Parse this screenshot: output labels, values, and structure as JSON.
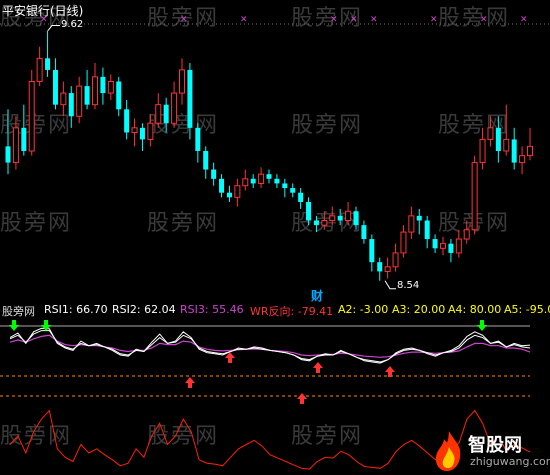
{
  "title": "平安银行(日线)",
  "price_high_label": "9.62",
  "price_low_label": "8.54",
  "finance_marker": "财",
  "indicator": {
    "name": "股旁网",
    "items": [
      {
        "text": "RSI1: 66.70",
        "color": "#ffffff"
      },
      {
        "text": "RSI2: 62.04",
        "color": "#ffffff"
      },
      {
        "text": "RSI3: 55.46",
        "color": "#cc44cc"
      },
      {
        "text": "WR反向: -79.41",
        "color": "#ff3333"
      },
      {
        "text": "A2: -3.00",
        "color": "#ffff00"
      },
      {
        "text": "A3: 20.00",
        "color": "#ffff00"
      },
      {
        "text": "A4: 80.00",
        "color": "#ffff00"
      },
      {
        "text": "A5: -95.0",
        "color": "#ffff00"
      }
    ]
  },
  "watermarks": [
    "股旁网",
    "股旁网",
    "股旁网",
    "股旁网",
    "股旁网",
    "股旁网",
    "股旁网",
    "股旁网",
    "股旁网",
    "股旁网",
    "股旁网",
    "股旁网",
    "股旁网",
    "股旁网",
    "股旁网"
  ],
  "logo": {
    "name": "智股网",
    "url": "zhiguwang.com"
  },
  "colors": {
    "up": "#ff3333",
    "down": "#00ffff",
    "rsi1": "#ffffff",
    "rsi2": "#ffffff",
    "rsi3": "#cc44cc",
    "wr": "#ff2200",
    "dashed": "#ff8800",
    "arrow_up": "#ff3333",
    "arrow_down": "#00ff00"
  },
  "chart_data": [
    {
      "type": "candlestick",
      "title": "平安银行(日线)",
      "annotations": [
        {
          "label": "9.62",
          "type": "high"
        },
        {
          "label": "8.54",
          "type": "low"
        }
      ],
      "candles": [
        [
          9.12,
          9.05,
          9.28,
          9.0
        ],
        [
          9.05,
          9.2,
          9.25,
          9.02
        ],
        [
          9.2,
          9.1,
          9.3,
          9.08
        ],
        [
          9.1,
          9.4,
          9.45,
          9.08
        ],
        [
          9.4,
          9.5,
          9.55,
          9.38
        ],
        [
          9.5,
          9.45,
          9.62,
          9.42
        ],
        [
          9.45,
          9.3,
          9.5,
          9.28
        ],
        [
          9.3,
          9.35,
          9.4,
          9.25
        ],
        [
          9.35,
          9.25,
          9.38,
          9.2
        ],
        [
          9.25,
          9.38,
          9.42,
          9.22
        ],
        [
          9.38,
          9.3,
          9.45,
          9.28
        ],
        [
          9.3,
          9.42,
          9.48,
          9.28
        ],
        [
          9.42,
          9.35,
          9.46,
          9.3
        ],
        [
          9.35,
          9.4,
          9.43,
          9.32
        ],
        [
          9.4,
          9.28,
          9.42,
          9.25
        ],
        [
          9.28,
          9.18,
          9.32,
          9.15
        ],
        [
          9.18,
          9.2,
          9.24,
          9.12
        ],
        [
          9.2,
          9.15,
          9.22,
          9.1
        ],
        [
          9.15,
          9.22,
          9.26,
          9.12
        ],
        [
          9.22,
          9.3,
          9.35,
          9.2
        ],
        [
          9.3,
          9.22,
          9.33,
          9.18
        ],
        [
          9.22,
          9.35,
          9.4,
          9.2
        ],
        [
          9.35,
          9.45,
          9.5,
          9.3
        ],
        [
          9.45,
          9.2,
          9.48,
          9.15
        ],
        [
          9.2,
          9.1,
          9.22,
          9.05
        ],
        [
          9.1,
          9.02,
          9.12,
          8.98
        ],
        [
          9.02,
          8.98,
          9.05,
          8.95
        ],
        [
          8.98,
          8.92,
          9.0,
          8.9
        ],
        [
          8.92,
          8.9,
          8.95,
          8.88
        ],
        [
          8.9,
          8.95,
          8.98,
          8.86
        ],
        [
          8.95,
          8.98,
          9.02,
          8.93
        ],
        [
          8.98,
          8.96,
          9.0,
          8.94
        ],
        [
          8.96,
          9.0,
          9.03,
          8.94
        ],
        [
          9.0,
          8.98,
          9.02,
          8.96
        ],
        [
          8.98,
          8.96,
          9.0,
          8.94
        ],
        [
          8.96,
          8.94,
          8.98,
          8.9
        ],
        [
          8.94,
          8.92,
          8.96,
          8.9
        ],
        [
          8.92,
          8.88,
          8.94,
          8.85
        ],
        [
          8.88,
          8.8,
          8.9,
          8.78
        ],
        [
          8.8,
          8.78,
          8.82,
          8.75
        ],
        [
          8.78,
          8.8,
          8.84,
          8.76
        ],
        [
          8.8,
          8.82,
          8.86,
          8.78
        ],
        [
          8.82,
          8.8,
          8.85,
          8.78
        ],
        [
          8.8,
          8.84,
          8.88,
          8.78
        ],
        [
          8.84,
          8.78,
          8.86,
          8.76
        ],
        [
          8.78,
          8.72,
          8.8,
          8.7
        ],
        [
          8.72,
          8.62,
          8.74,
          8.58
        ],
        [
          8.62,
          8.58,
          8.64,
          8.54
        ],
        [
          8.58,
          8.6,
          8.64,
          8.55
        ],
        [
          8.6,
          8.66,
          8.7,
          8.58
        ],
        [
          8.66,
          8.75,
          8.78,
          8.64
        ],
        [
          8.75,
          8.82,
          8.86,
          8.72
        ],
        [
          8.82,
          8.8,
          8.85,
          8.74
        ],
        [
          8.8,
          8.72,
          8.82,
          8.68
        ],
        [
          8.72,
          8.68,
          8.74,
          8.66
        ],
        [
          8.68,
          8.7,
          8.73,
          8.65
        ],
        [
          8.7,
          8.66,
          8.72,
          8.62
        ],
        [
          8.66,
          8.72,
          8.76,
          8.64
        ],
        [
          8.72,
          8.76,
          8.8,
          8.7
        ],
        [
          8.76,
          9.05,
          9.08,
          8.74
        ],
        [
          9.05,
          9.15,
          9.2,
          9.02
        ],
        [
          9.15,
          9.2,
          9.25,
          9.12
        ],
        [
          9.2,
          9.1,
          9.25,
          9.05
        ],
        [
          9.1,
          9.15,
          9.3,
          9.08
        ],
        [
          9.15,
          9.05,
          9.2,
          9.02
        ],
        [
          9.05,
          9.08,
          9.12,
          9.0
        ],
        [
          9.08,
          9.12,
          9.2,
          9.06
        ]
      ]
    },
    {
      "type": "line",
      "title": "股旁网",
      "series": [
        {
          "name": "RSI1",
          "values": [
            80,
            88,
            70,
            90,
            96,
            95,
            70,
            62,
            58,
            74,
            66,
            70,
            64,
            58,
            50,
            48,
            60,
            56,
            72,
            86,
            70,
            74,
            90,
            80,
            60,
            54,
            52,
            50,
            56,
            62,
            60,
            64,
            62,
            58,
            56,
            54,
            50,
            42,
            40,
            48,
            52,
            50,
            58,
            52,
            46,
            40,
            38,
            36,
            42,
            54,
            60,
            62,
            58,
            52,
            48,
            54,
            58,
            66,
            82,
            90,
            84,
            70,
            74,
            64,
            70,
            66,
            67
          ]
        },
        {
          "name": "RSI2",
          "values": [
            78,
            84,
            72,
            86,
            92,
            92,
            72,
            64,
            60,
            70,
            66,
            68,
            64,
            60,
            52,
            50,
            58,
            56,
            68,
            80,
            70,
            72,
            84,
            78,
            62,
            56,
            54,
            52,
            56,
            60,
            60,
            62,
            60,
            58,
            56,
            54,
            50,
            44,
            42,
            48,
            50,
            50,
            56,
            52,
            46,
            42,
            40,
            38,
            42,
            52,
            58,
            60,
            58,
            54,
            50,
            54,
            56,
            62,
            76,
            84,
            80,
            70,
            72,
            64,
            68,
            64,
            62
          ]
        },
        {
          "name": "RSI3",
          "values": [
            72,
            76,
            72,
            78,
            82,
            84,
            74,
            68,
            66,
            68,
            66,
            66,
            64,
            62,
            58,
            56,
            58,
            58,
            62,
            70,
            68,
            68,
            74,
            72,
            64,
            60,
            58,
            57,
            58,
            59,
            60,
            60,
            60,
            58,
            57,
            56,
            54,
            50,
            49,
            50,
            51,
            51,
            53,
            52,
            50,
            48,
            47,
            46,
            47,
            50,
            53,
            55,
            55,
            54,
            53,
            54,
            55,
            57,
            64,
            70,
            70,
            66,
            66,
            62,
            62,
            60,
            55
          ]
        },
        {
          "name": "WR反向",
          "values": [
            -70,
            -60,
            -80,
            -55,
            -40,
            -30,
            -75,
            -85,
            -90,
            -70,
            -80,
            -75,
            -82,
            -88,
            -95,
            -92,
            -75,
            -85,
            -60,
            -45,
            -70,
            -60,
            -40,
            -55,
            -88,
            -92,
            -93,
            -95,
            -85,
            -75,
            -70,
            -65,
            -72,
            -82,
            -86,
            -90,
            -94,
            -98,
            -99,
            -90,
            -85,
            -86,
            -78,
            -82,
            -90,
            -96,
            -97,
            -98,
            -92,
            -78,
            -70,
            -65,
            -72,
            -80,
            -88,
            -82,
            -76,
            -68,
            -40,
            -30,
            -45,
            -70,
            -60,
            -78,
            -70,
            -74,
            -79
          ]
        }
      ],
      "levels": [
        -3.0,
        20.0,
        80.0,
        -95.0
      ]
    }
  ]
}
